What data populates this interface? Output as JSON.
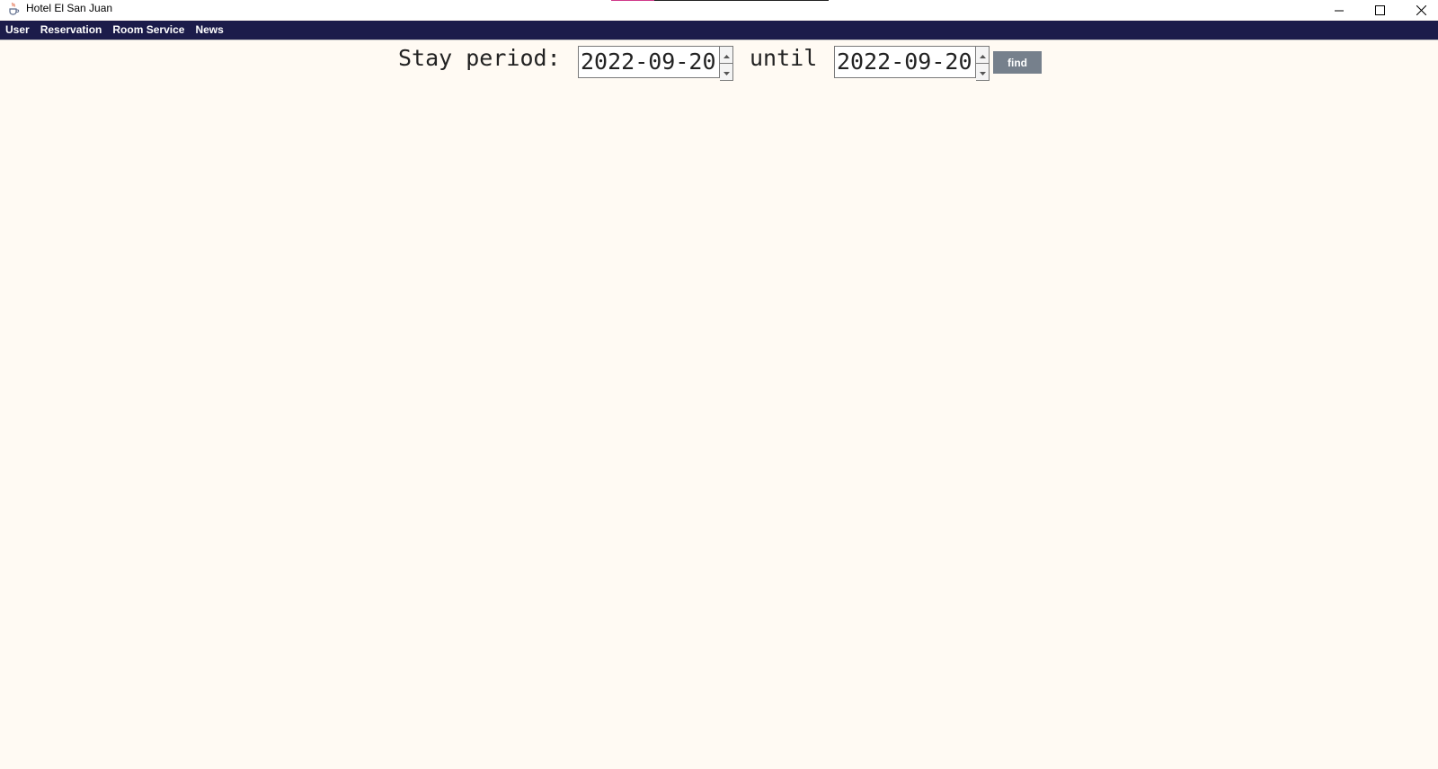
{
  "window": {
    "title": "Hotel El San Juan",
    "icon": "java-cup-icon",
    "controls": [
      "minimize-icon",
      "maximize-icon",
      "close-icon"
    ]
  },
  "menubar": {
    "items": [
      "User",
      "Reservation",
      "Room Service",
      "News"
    ],
    "background": "#1c1c4a"
  },
  "search": {
    "stay_label": "Stay period:",
    "from_date": "2022-09-20",
    "until_label": "until",
    "to_date": "2022-09-20",
    "find_label": "find"
  },
  "colors": {
    "background": "#fffaf3",
    "button": "#76808c"
  }
}
